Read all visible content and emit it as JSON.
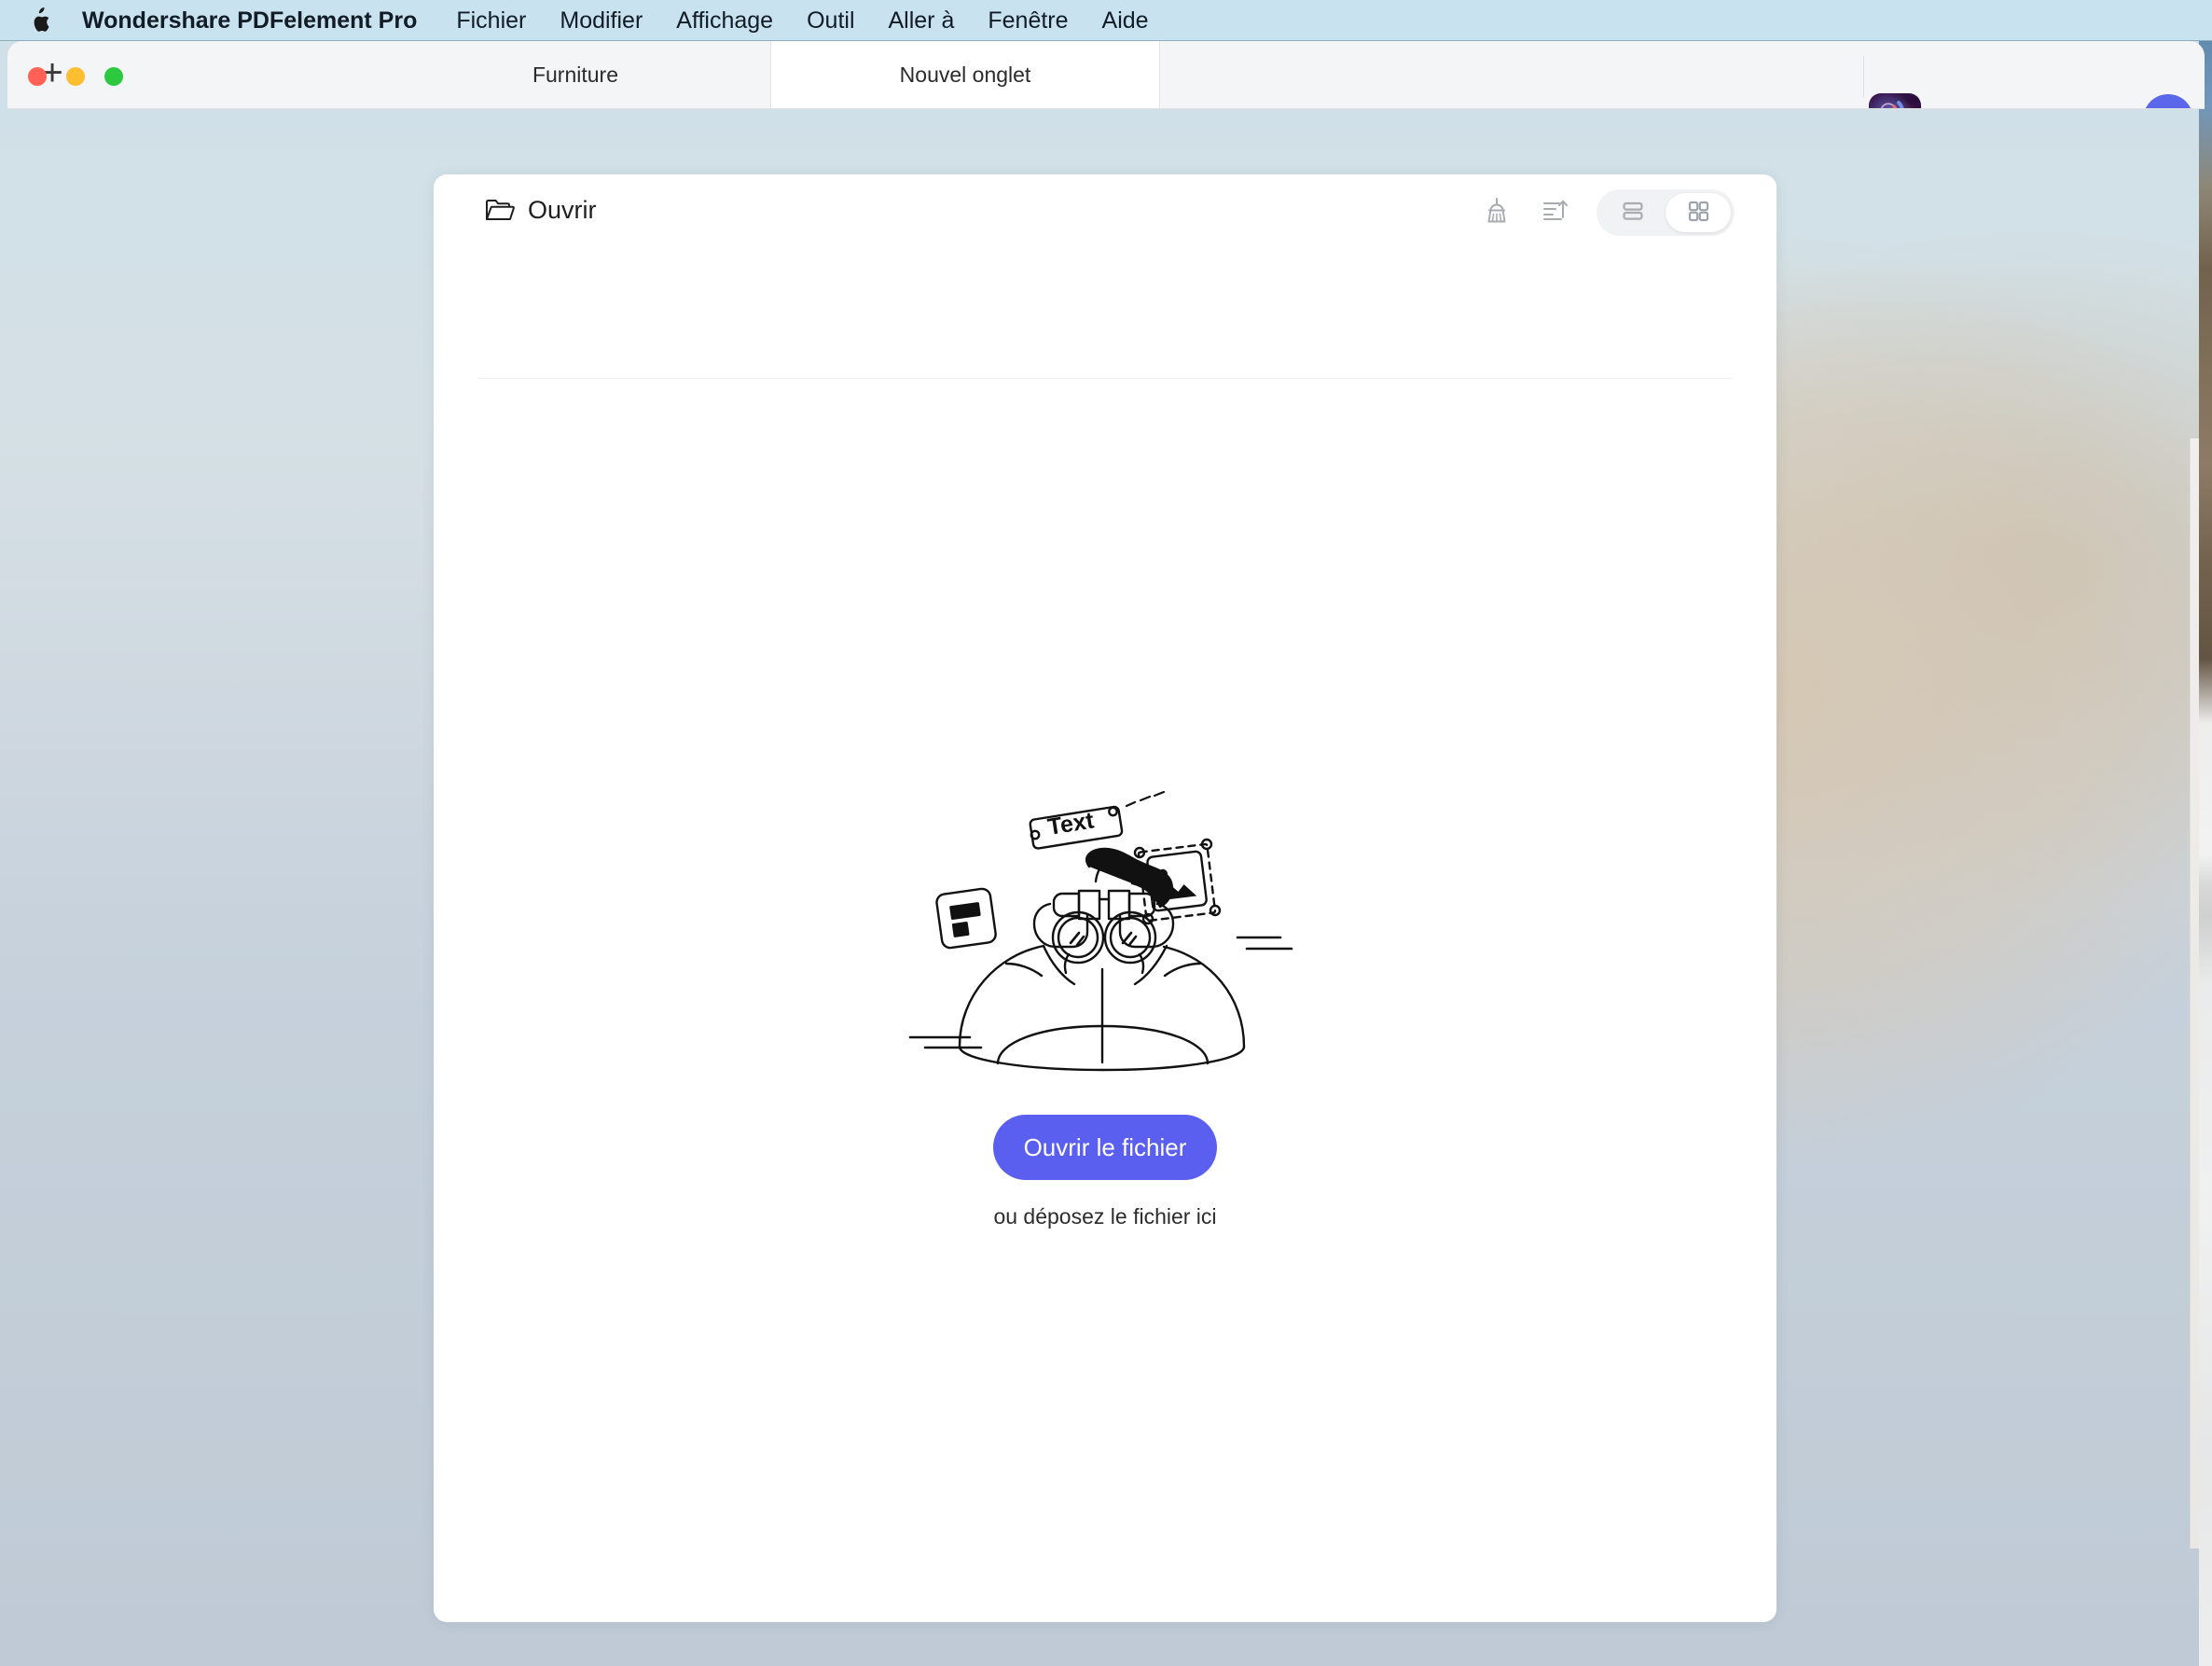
{
  "menubar": {
    "apple_icon": "apple-logo-icon",
    "app_name": "Wondershare PDFelement Pro",
    "items": [
      {
        "label": "Fichier"
      },
      {
        "label": "Modifier"
      },
      {
        "label": "Affichage"
      },
      {
        "label": "Outil"
      },
      {
        "label": "Aller à"
      },
      {
        "label": "Fenêtre"
      },
      {
        "label": "Aide"
      }
    ]
  },
  "window": {
    "traffic_lights": {
      "close_color": "#ff6159",
      "minimize_color": "#ffbe2f",
      "maximize_color": "#2bc840"
    },
    "tabs": [
      {
        "label": "Furniture",
        "active": false
      },
      {
        "label": "Nouvel onglet",
        "active": true
      }
    ],
    "new_tab_button": "+",
    "app_badge_icon": "wondershare-app-icon",
    "avatar_icon": "user-avatar-icon"
  },
  "panel": {
    "header": {
      "folder_icon": "open-folder-icon",
      "title": "Ouvrir",
      "tools": [
        {
          "name": "clear-recent",
          "icon": "broom-icon"
        },
        {
          "name": "sort",
          "icon": "sort-ascending-icon"
        }
      ],
      "view_toggle": {
        "list_icon": "list-view-icon",
        "grid_icon": "grid-view-icon",
        "selected": "grid"
      }
    },
    "empty_state": {
      "illustration": "person-with-binoculars-illustration",
      "illustration_text_tag": "Text",
      "open_button_label": "Ouvrir le fichier",
      "open_button_color": "#5b5ff0",
      "drop_hint": "ou déposez le fichier ici"
    }
  }
}
